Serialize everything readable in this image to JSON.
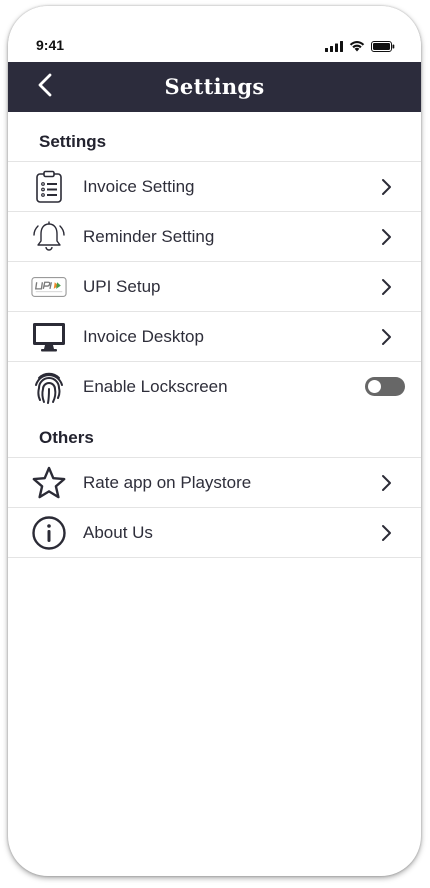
{
  "status_bar": {
    "time": "9:41"
  },
  "header": {
    "title": "Settings",
    "back_icon": "chevron-left-icon",
    "background": "#2c2c3c"
  },
  "sections": {
    "settings": {
      "title": "Settings",
      "items": [
        {
          "label": "Invoice Setting",
          "icon": "clipboard-list-icon",
          "control": "chevron"
        },
        {
          "label": "Reminder Setting",
          "icon": "bell-ringing-icon",
          "control": "chevron"
        },
        {
          "label": "UPI Setup",
          "icon": "upi-logo-icon",
          "control": "chevron"
        },
        {
          "label": "Invoice Desktop",
          "icon": "desktop-monitor-icon",
          "control": "chevron"
        },
        {
          "label": "Enable Lockscreen",
          "icon": "fingerprint-icon",
          "control": "toggle",
          "toggle_on": false
        }
      ]
    },
    "others": {
      "title": "Others",
      "items": [
        {
          "label": "Rate app on Playstore",
          "icon": "star-icon",
          "control": "chevron"
        },
        {
          "label": "About Us",
          "icon": "info-icon",
          "control": "chevron"
        }
      ]
    }
  },
  "colors": {
    "text_dark": "#2e2e3a",
    "divider": "#e4e4e4",
    "toggle_off": "#676767"
  }
}
